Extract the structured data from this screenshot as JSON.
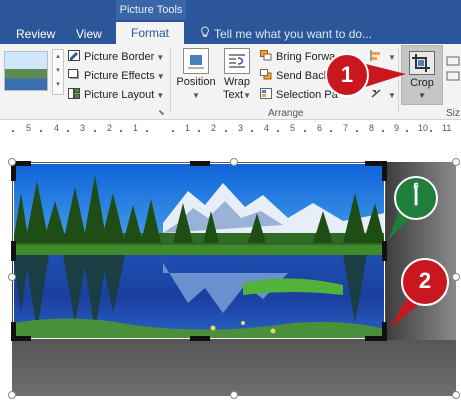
{
  "ribbon": {
    "context_tab_title": "Picture Tools",
    "tabs": [
      "Review",
      "View",
      "Format"
    ],
    "active_tab": "Format",
    "tell_me_placeholder": "Tell me what you want to do...",
    "picture_styles": {
      "picture_border": "Picture Border",
      "picture_effects": "Picture Effects",
      "picture_layout": "Picture Layout"
    },
    "arrange": {
      "position": "Position",
      "wrap_text": "Wrap Text",
      "bring_forward": "Bring Forwa",
      "send_backward": "Send Back",
      "selection_pane": "Selection Pa",
      "group_label": "Arrange"
    },
    "size": {
      "crop": "Crop",
      "group_label_partial": "Siz"
    }
  },
  "ruler": {
    "numbers": [
      "5",
      "4",
      "3",
      "2",
      "1",
      "1",
      "2",
      "3",
      "4",
      "5",
      "6",
      "7",
      "8",
      "9",
      "10",
      "11"
    ]
  },
  "annotations": {
    "callout_1": "1",
    "callout_2": "2",
    "callout_alef": "أ",
    "callout_red_color": "#c8171e",
    "callout_green_color": "#1e7e3a"
  },
  "colors": {
    "title_bar": "#2b579a",
    "ribbon_bg": "#f3f3f3",
    "crop_selected": "#c6c6c6"
  }
}
